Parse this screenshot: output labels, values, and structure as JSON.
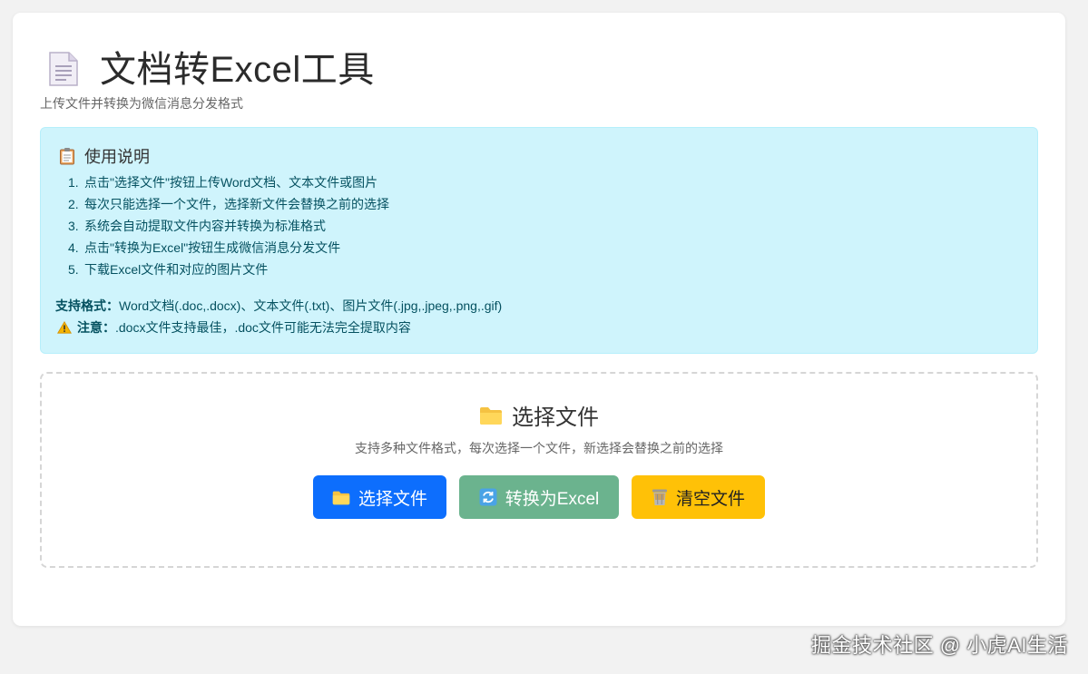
{
  "header": {
    "title": "文档转Excel工具",
    "subtitle": "上传文件并转换为微信消息分发格式"
  },
  "instructions": {
    "heading": "使用说明",
    "steps": [
      {
        "num": "1.",
        "text": "点击\"选择文件\"按钮上传Word文档、文本文件或图片"
      },
      {
        "num": "2.",
        "text": "每次只能选择一个文件，选择新文件会替换之前的选择"
      },
      {
        "num": "3.",
        "text": "系统会自动提取文件内容并转换为标准格式"
      },
      {
        "num": "4.",
        "text": "点击\"转换为Excel\"按钮生成微信消息分发文件"
      },
      {
        "num": "5.",
        "text": "下载Excel文件和对应的图片文件"
      }
    ],
    "formats_label": "支持格式：",
    "formats_text": "Word文档(.doc,.docx)、文本文件(.txt)、图片文件(.jpg,.jpeg,.png,.gif)",
    "note_label": "注意：",
    "note_text": ".docx文件支持最佳，.doc文件可能无法完全提取内容"
  },
  "upload": {
    "heading": "选择文件",
    "description": "支持多种文件格式，每次选择一个文件，新选择会替换之前的选择",
    "select_label": "选择文件",
    "convert_label": "转换为Excel",
    "clear_label": "清空文件"
  },
  "colors": {
    "primary": "#0d6efd",
    "success_disabled": "#6bb38e",
    "warning": "#ffc107",
    "info_bg": "#cff4fc"
  },
  "icons": [
    "document-icon",
    "clipboard-icon",
    "warning-icon",
    "folder-icon",
    "refresh-icon",
    "wastebasket-icon"
  ],
  "watermark": "掘金技术社区 @ 小虎AI生活"
}
